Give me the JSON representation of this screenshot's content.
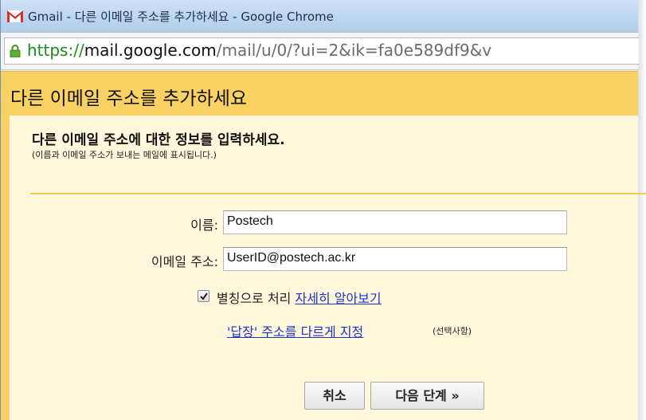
{
  "window": {
    "title": "Gmail - 다른 이메일 주소를 추가하세요 - Google Chrome"
  },
  "address_bar": {
    "scheme": "https://",
    "host": "mail.google.com",
    "path": "/mail/u/0/?ui=2&ik=fa0e589df9&v"
  },
  "dialog": {
    "header": "다른 이메일 주소를 추가하세요",
    "section_title": "다른 이메일 주소에 대한 정보를 입력하세요.",
    "section_subtitle": "(이름과 이메일 주소가 보내는 메일에 표시됩니다.)",
    "name_label": "이름:",
    "name_value": "Postech",
    "email_label": "이메일 주소:",
    "email_value": "UserID@postech.ac.kr",
    "alias_checked": true,
    "alias_label": "별칭으로 처리",
    "learn_more_link": "자세히 알아보기",
    "reply_to_link": "'답장' 주소를 다르게 지정",
    "optional_note": "(선택사항)",
    "cancel_button": "취소",
    "next_button": "다음 단계 »"
  },
  "colors": {
    "header_bg": "#fad163",
    "content_bg": "#fff7dc",
    "link": "#1a34c6",
    "secure_scheme": "#1e8a1e"
  },
  "icons": {
    "tab_icon": "gmail-logo-icon",
    "secure": "lock-icon",
    "checkbox": "checkmark-icon"
  }
}
